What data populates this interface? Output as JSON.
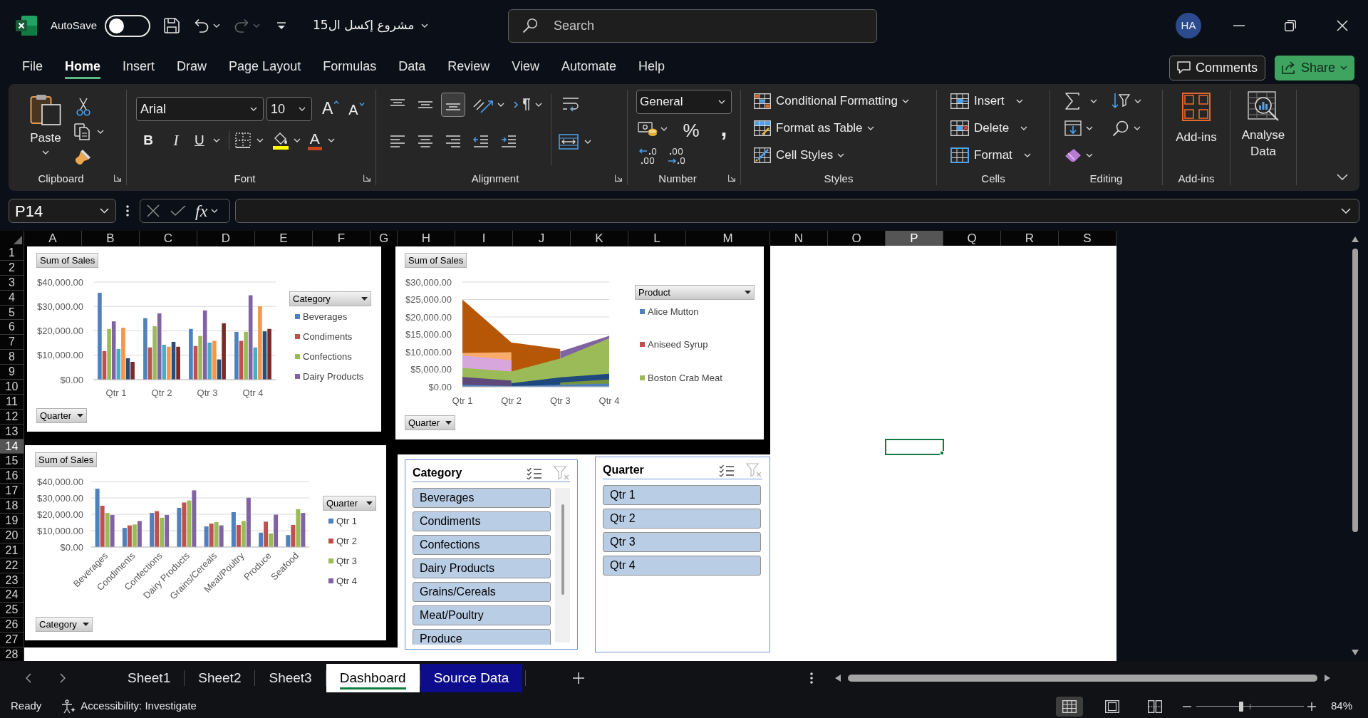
{
  "title_bar": {
    "autosave": {
      "label": "AutoSave",
      "on": false
    },
    "redo_disabled": true,
    "document_title": "مشروع إكسل ال15",
    "search": {
      "placeholder": "Search"
    },
    "avatar_initials": "HA"
  },
  "menu_tabs": [
    {
      "label": "File",
      "selected": false
    },
    {
      "label": "Home",
      "selected": true
    },
    {
      "label": "Insert",
      "selected": false
    },
    {
      "label": "Draw",
      "selected": false
    },
    {
      "label": "Page Layout",
      "selected": false
    },
    {
      "label": "Formulas",
      "selected": false
    },
    {
      "label": "Data",
      "selected": false
    },
    {
      "label": "Review",
      "selected": false
    },
    {
      "label": "View",
      "selected": false
    },
    {
      "label": "Automate",
      "selected": false
    },
    {
      "label": "Help",
      "selected": false
    }
  ],
  "comments_button": "Comments",
  "share_button": "Share",
  "ribbon": {
    "clipboard": {
      "paste_label": "Paste",
      "group_label": "Clipboard"
    },
    "font": {
      "font_name": "Arial",
      "font_size": "10",
      "grow_font_label": "A",
      "shrink_font_label": "A",
      "bold_label": "B",
      "italic_label": "I",
      "underline_label": "U",
      "font_color_label": "A",
      "group_label": "Font"
    },
    "alignment": {
      "vertical_align": [
        {
          "kind": "top",
          "selected": false
        },
        {
          "kind": "middle",
          "selected": false
        },
        {
          "kind": "bottom",
          "selected": true
        }
      ],
      "group_label": "Alignment"
    },
    "number": {
      "format": "General",
      "percent_label": "%",
      "comma_label": ",",
      "group_label": "Number"
    },
    "styles": {
      "items": [
        {
          "kind": "conditional",
          "label": "Conditional Formatting"
        },
        {
          "kind": "table",
          "label": "Format as Table"
        },
        {
          "kind": "cell",
          "label": "Cell Styles"
        }
      ],
      "group_label": "Styles"
    },
    "cells": {
      "items": [
        {
          "kind": "insert",
          "label": "Insert"
        },
        {
          "kind": "delete",
          "label": "Delete"
        },
        {
          "kind": "format",
          "label": "Format"
        }
      ],
      "group_label": "Cells"
    },
    "editing": {
      "group_label": "Editing"
    },
    "add_ins": {
      "button_label": "Add-ins",
      "group_label": "Add-ins"
    },
    "analyse_data": {
      "button_label": "Analyse Data"
    }
  },
  "formula_bar": {
    "name_box": "P14",
    "function_label": "fx"
  },
  "columns": [
    {
      "label": "A",
      "selected": false
    },
    {
      "label": "B",
      "selected": false
    },
    {
      "label": "C",
      "selected": false
    },
    {
      "label": "D",
      "selected": false
    },
    {
      "label": "E",
      "selected": false
    },
    {
      "label": "F",
      "selected": false
    },
    {
      "label": "G",
      "selected": false
    },
    {
      "label": "H",
      "selected": false
    },
    {
      "label": "I",
      "selected": false
    },
    {
      "label": "J",
      "selected": false
    },
    {
      "label": "K",
      "selected": false
    },
    {
      "label": "L",
      "selected": false
    },
    {
      "label": "M",
      "selected": false
    },
    {
      "label": "N",
      "selected": false
    },
    {
      "label": "O",
      "selected": false
    },
    {
      "label": "P",
      "selected": true
    },
    {
      "label": "Q",
      "selected": false
    },
    {
      "label": "R",
      "selected": false
    },
    {
      "label": "S",
      "selected": false
    }
  ],
  "rows": [
    {
      "label": "1",
      "selected": false
    },
    {
      "label": "2",
      "selected": false
    },
    {
      "label": "3",
      "selected": false
    },
    {
      "label": "4",
      "selected": false
    },
    {
      "label": "5",
      "selected": false
    },
    {
      "label": "6",
      "selected": false
    },
    {
      "label": "7",
      "selected": false
    },
    {
      "label": "8",
      "selected": false
    },
    {
      "label": "9",
      "selected": false
    },
    {
      "label": "10",
      "selected": false
    },
    {
      "label": "11",
      "selected": false
    },
    {
      "label": "12",
      "selected": false
    },
    {
      "label": "13",
      "selected": false
    },
    {
      "label": "14",
      "selected": true
    },
    {
      "label": "15",
      "selected": false
    },
    {
      "label": "16",
      "selected": false
    },
    {
      "label": "17",
      "selected": false
    },
    {
      "label": "18",
      "selected": false
    },
    {
      "label": "19",
      "selected": false
    },
    {
      "label": "20",
      "selected": false
    },
    {
      "label": "21",
      "selected": false
    },
    {
      "label": "22",
      "selected": false
    },
    {
      "label": "23",
      "selected": false
    },
    {
      "label": "24",
      "selected": false
    },
    {
      "label": "25",
      "selected": false
    },
    {
      "label": "26",
      "selected": false
    },
    {
      "label": "27",
      "selected": false
    },
    {
      "label": "28",
      "selected": false
    }
  ],
  "charts": [
    {
      "value_field": "Sum of Sales",
      "axis_field": "Quarter",
      "legend_field": "Category",
      "chart_data": {
        "type": "bar",
        "categories": [
          "Qtr 1",
          "Qtr 2",
          "Qtr 3",
          "Qtr 4"
        ],
        "ylim": [
          0,
          40000
        ],
        "yticks": [
          {
            "value": 0,
            "label": "$0.00"
          },
          {
            "value": 10000,
            "label": "$10,000.00"
          },
          {
            "value": 20000,
            "label": "$20,000.00"
          },
          {
            "value": 30000,
            "label": "$30,000.00"
          },
          {
            "value": 40000,
            "label": "$40,000.00"
          }
        ],
        "grid": true,
        "legend": "right",
        "series": [
          {
            "name": "Beverages",
            "color": "#4f81bd",
            "values": [
              35600,
              25200,
              20800,
              19600
            ]
          },
          {
            "name": "Condiments",
            "color": "#c0504d",
            "values": [
              11700,
              13200,
              13800,
              15900
            ]
          },
          {
            "name": "Confections",
            "color": "#9bbb59",
            "values": [
              20800,
              21900,
              17900,
              19600
            ]
          },
          {
            "name": "Dairy Products",
            "color": "#8064a2",
            "values": [
              23900,
              27200,
              28400,
              34600
            ]
          },
          {
            "color": "#4bacc6",
            "values": [
              12600,
              14300,
              15200,
              13200
            ]
          },
          {
            "color": "#f79646",
            "values": [
              21300,
              13500,
              15900,
              30100
            ]
          },
          {
            "color": "#2c4d75",
            "values": [
              8800,
              15500,
              8300,
              19800
            ]
          },
          {
            "color": "#772c2a",
            "values": [
              7300,
              13500,
              23100,
              20800
            ]
          }
        ]
      }
    },
    {
      "value_field": "Sum of Sales",
      "axis_field": "Quarter",
      "legend_field": "Product",
      "chart_data": {
        "type": "area",
        "categories": [
          "Qtr 1",
          "Qtr 2",
          "Qtr 3",
          "Qtr 4"
        ],
        "ylim": [
          0,
          30000
        ],
        "yticks": [
          {
            "value": 0,
            "label": "$0.00"
          },
          {
            "value": 5000,
            "label": "$5,000.00"
          },
          {
            "value": 10000,
            "label": "$10,000.00"
          },
          {
            "value": 15000,
            "label": "$15,000.00"
          },
          {
            "value": 20000,
            "label": "$20,000.00"
          },
          {
            "value": 25000,
            "label": "$25,000.00"
          },
          {
            "value": 30000,
            "label": "$30,000.00"
          }
        ],
        "grid": true,
        "legend": "right",
        "series": [
          {
            "name": "Alice Mutton",
            "color": "#4f81bd",
            "values": [
              600,
              200,
              600,
              900
            ]
          },
          {
            "name": "Aniseed Syrup",
            "color": "#c0504d",
            "values": [
              null,
              null,
              null,
              null
            ]
          },
          {
            "color": "#77933c",
            "values": [
              null,
              null,
              1200,
              2100
            ]
          },
          {
            "color": "#1f497d",
            "values": [
              null,
              1000,
              2700,
              3700
            ]
          },
          {
            "color": "#5f497a",
            "values": [
              2800,
              1800,
              null,
              null
            ]
          },
          {
            "name": "Boston Crab Meat",
            "color": "#9bbb59",
            "values": [
              5400,
              4400,
              8100,
              13900
            ]
          },
          {
            "color": "#d6a6dc",
            "values": [
              9000,
              7600,
              null,
              null
            ]
          },
          {
            "color": "#f9ab6b",
            "values": [
              9700,
              9900,
              null,
              null
            ]
          },
          {
            "color": "#8064a2",
            "values": [
              null,
              null,
              10100,
              14600
            ]
          },
          {
            "color": "#b65708",
            "values": [
              25000,
              12700,
              10800,
              null
            ]
          }
        ]
      }
    },
    {
      "value_field": "Sum of Sales",
      "axis_field": "Category",
      "legend_field": "Quarter",
      "chart_data": {
        "type": "bar",
        "categories": [
          "Beverages",
          "Condiments",
          "Confections",
          "Dairy Products",
          "Grains/Cereals",
          "Meat/Poultry",
          "Produce",
          "Seafood"
        ],
        "ylim": [
          0,
          40000
        ],
        "yticks": [
          {
            "value": 0,
            "label": "$0.00"
          },
          {
            "value": 10000,
            "label": "$10,000.00"
          },
          {
            "value": 20000,
            "label": "$20,000.00"
          },
          {
            "value": 30000,
            "label": "$30,000.00"
          },
          {
            "value": 40000,
            "label": "$40,000.00"
          }
        ],
        "grid": true,
        "legend": "right",
        "series": [
          {
            "name": "Qtr 1",
            "color": "#4f81bd",
            "values": [
              35600,
              11700,
              20800,
              23900,
              12600,
              21300,
              8800,
              7300
            ]
          },
          {
            "name": "Qtr 2",
            "color": "#c0504d",
            "values": [
              25200,
              13200,
              21900,
              27200,
              14300,
              13500,
              15500,
              13500
            ]
          },
          {
            "name": "Qtr 3",
            "color": "#9bbb59",
            "values": [
              20800,
              13800,
              17900,
              28400,
              15200,
              15900,
              8300,
              23100
            ]
          },
          {
            "name": "Qtr 4",
            "color": "#8064a2",
            "values": [
              19600,
              15900,
              19600,
              34600,
              13200,
              30100,
              19800,
              20800
            ]
          }
        ]
      }
    }
  ],
  "slicers": [
    {
      "title": "Category",
      "items": [
        {
          "label": "Beverages",
          "selected": true
        },
        {
          "label": "Condiments",
          "selected": true
        },
        {
          "label": "Confections",
          "selected": true
        },
        {
          "label": "Dairy Products",
          "selected": true
        },
        {
          "label": "Grains/Cereals",
          "selected": true
        },
        {
          "label": "Meat/Poultry",
          "selected": true
        },
        {
          "label": "Produce",
          "selected": true
        }
      ]
    },
    {
      "title": "Quarter",
      "items": [
        {
          "label": "Qtr 1",
          "selected": true
        },
        {
          "label": "Qtr 2",
          "selected": true
        },
        {
          "label": "Qtr 3",
          "selected": true
        },
        {
          "label": "Qtr 4",
          "selected": true
        }
      ]
    }
  ],
  "sheet_tabs": [
    {
      "label": "Sheet1",
      "selected": false
    },
    {
      "label": "Sheet2",
      "selected": false
    },
    {
      "label": "Sheet3",
      "selected": false
    },
    {
      "label": "Dashboard",
      "selected": true
    },
    {
      "label": "Source Data",
      "selected": false,
      "color": "#0c0c8c"
    }
  ],
  "status_bar": {
    "status": "Ready",
    "accessibility": "Accessibility: Investigate",
    "views": [
      {
        "kind": "normal",
        "selected": true
      },
      {
        "kind": "page_layout",
        "selected": false
      },
      {
        "kind": "page_break",
        "selected": false
      }
    ],
    "zoom": {
      "level": 0.42,
      "label": "84%"
    }
  }
}
